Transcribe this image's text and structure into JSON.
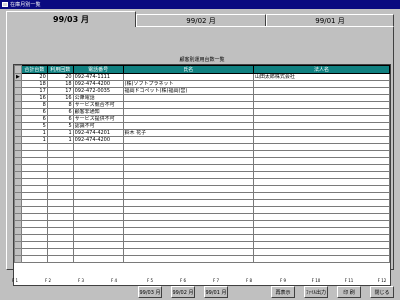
{
  "window": {
    "title": "在庫月別一覧"
  },
  "tabs": [
    {
      "label": "99/03 月",
      "active": true
    },
    {
      "label": "99/02 月",
      "active": false
    },
    {
      "label": "99/01 月",
      "active": false
    }
  ],
  "grid": {
    "caption": "顧客別運用台数一覧",
    "headers": [
      "合計台数",
      "利用回数",
      "電話番号",
      "氏名",
      "法人名"
    ],
    "rows": [
      {
        "indicator": "▶",
        "total": "20",
        "uses": "20",
        "phone": "092-474-1111",
        "name": "",
        "corp": "山田太郎株式会社"
      },
      {
        "indicator": "",
        "total": "18",
        "uses": "18",
        "phone": "092-474-4200",
        "name": "(株)ソフトプラネット",
        "corp": ""
      },
      {
        "indicator": "",
        "total": "17",
        "uses": "17",
        "phone": "092-472-0035",
        "name": "福岡ドコペット(株)福岡(営)",
        "corp": ""
      },
      {
        "indicator": "",
        "total": "16",
        "uses": "16",
        "phone": "公衆電話",
        "name": "",
        "corp": ""
      },
      {
        "indicator": "",
        "total": "8",
        "uses": "8",
        "phone": "サービス競合不可",
        "name": "",
        "corp": ""
      },
      {
        "indicator": "",
        "total": "6",
        "uses": "6",
        "phone": "顧客非通知",
        "name": "",
        "corp": ""
      },
      {
        "indicator": "",
        "total": "6",
        "uses": "6",
        "phone": "サービス提供不可",
        "name": "",
        "corp": ""
      },
      {
        "indicator": "",
        "total": "5",
        "uses": "5",
        "phone": "認識不可",
        "name": "",
        "corp": ""
      },
      {
        "indicator": "",
        "total": "1",
        "uses": "1",
        "phone": "092-474-4201",
        "name": "鈴木 花子",
        "corp": ""
      },
      {
        "indicator": "",
        "total": "1",
        "uses": "1",
        "phone": "092-474-4200",
        "name": "",
        "corp": ""
      }
    ]
  },
  "function_keys": [
    {
      "key": "F 1",
      "label": ""
    },
    {
      "key": "F 2",
      "label": ""
    },
    {
      "key": "F 3",
      "label": ""
    },
    {
      "key": "F 4",
      "label": ""
    },
    {
      "key": "F 5",
      "label": "99/03 月"
    },
    {
      "key": "F 6",
      "label": "99/02 月"
    },
    {
      "key": "F 7",
      "label": "99/01 月"
    },
    {
      "key": "F 8",
      "label": ""
    },
    {
      "key": "F 9",
      "label": "再表示"
    },
    {
      "key": "F 10",
      "label": "ﾌｧｲﾙ出力"
    },
    {
      "key": "F 11",
      "label": "印 刷"
    },
    {
      "key": "F 12",
      "label": "閉じる"
    }
  ]
}
